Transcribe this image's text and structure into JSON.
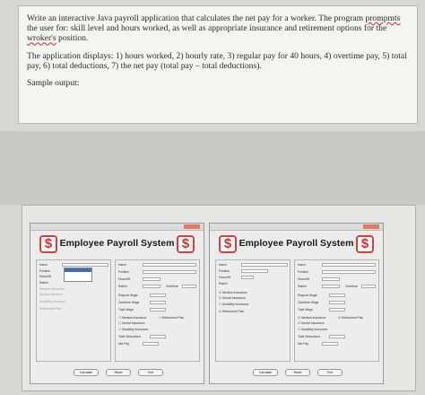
{
  "document": {
    "paragraph1_a": "Write an interactive Java payroll application that calculates the net pay for a worker. The program ",
    "paragraph1_prob": "prompmts",
    "paragraph1_b": " the user for: skill level and hours worked, as well as appropriate insurance and retirement options for the ",
    "paragraph1_prob2": "wroker's",
    "paragraph1_c": " position.",
    "paragraph2": "The application displays: 1) hours worked, 2) hourly rate, 3) regular pay for 40 hours, 4) overtime pay, 5) total pay, 6) total deductions, 7) the net pay (total pay – total deductions).",
    "paragraph3": "Sample output:"
  },
  "windows": [
    {
      "title": "Employee Payroll System",
      "dollar": "$",
      "left": {
        "name": "Name",
        "position": "Position",
        "position_value": "",
        "hours": "Hours/W",
        "rate": "Rate/h",
        "dropdown": [
          "",
          "",
          "",
          ""
        ],
        "medical": "Medical Insurance",
        "dental": "Dental Insurance",
        "disability": "Disability Insurance",
        "retirement": "Retirement Plan"
      },
      "right": {
        "name": "Name",
        "position": "Position",
        "hours": "Hours/W",
        "rate": "Rate/h",
        "overtime": "Overtime",
        "regular_wage": "Regular Wage",
        "overtime_wage": "Overtime Wage",
        "total_wage": "Total Wage",
        "medical": "Medical Insurance",
        "retirement": "Retirement Plan",
        "dental": "Dental Insurance",
        "disability": "Disability Insurance",
        "total_deductions": "Total Deductions",
        "net_pay": "Net Pay"
      },
      "buttons": [
        "Calculate",
        "Reset",
        "Exit"
      ]
    },
    {
      "title": "Employee Payroll System",
      "dollar": "$",
      "left": {
        "name": "Name",
        "position": "Position",
        "hours": "Hours/W",
        "rate": "Rate/h",
        "medical": "Medical Insurance",
        "dental": "Dental Insurance",
        "disability": "Disability Insurance",
        "retirement": "Retirement Plan"
      },
      "right": {
        "name": "Name",
        "position": "Position",
        "hours": "Hours/W",
        "rate": "Rate/h",
        "overtime": "Overtime",
        "regular_wage": "Regular Wage",
        "overtime_wage": "Overtime Wage",
        "total_wage": "Total Wage",
        "medical": "Medical Insurance",
        "retirement": "Retirement Plan",
        "dental": "Dental Insurance",
        "disability": "Disability Insurance",
        "total_deductions": "Total Deductions",
        "net_pay": "Net Pay"
      },
      "buttons": [
        "Calculate",
        "Reset",
        "Exit"
      ]
    }
  ]
}
